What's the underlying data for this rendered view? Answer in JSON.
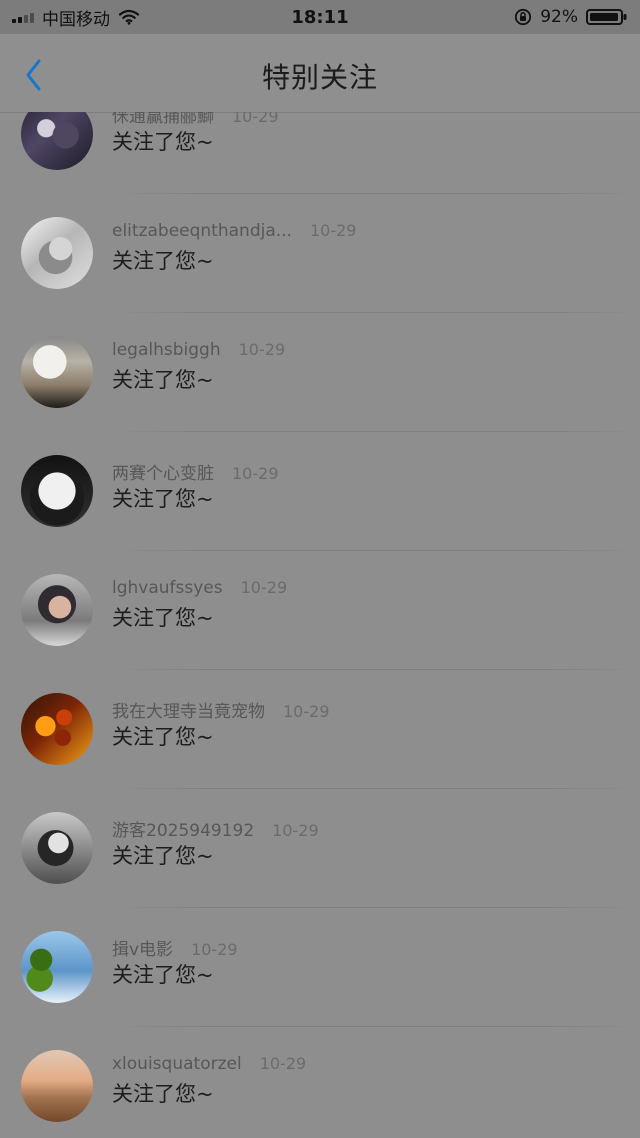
{
  "status_bar": {
    "carrier": "中国移动",
    "time": "18:11",
    "battery_percent": "92%",
    "icons": {
      "signal": "signal-icon",
      "wifi": "wifi-icon",
      "rotation_lock": "rotation-lock-icon",
      "battery": "battery-icon"
    }
  },
  "header": {
    "title": "特别关注",
    "back_icon": "back-icon",
    "accent_color": "#1677c9"
  },
  "feed": [
    {
      "username": "侎逋贏捅郦鰤",
      "time": "10-29",
      "message": "关注了您~",
      "avatar": "avatar-1"
    },
    {
      "username": "elitzabeeqnthandja...",
      "time": "10-29",
      "message": "关注了您~",
      "avatar": "avatar-2"
    },
    {
      "username": "legalhsbiggh",
      "time": "10-29",
      "message": "关注了您~",
      "avatar": "avatar-3"
    },
    {
      "username": "两賽个心变脏",
      "time": "10-29",
      "message": "关注了您~",
      "avatar": "avatar-4"
    },
    {
      "username": "lghvaufssyes",
      "time": "10-29",
      "message": "关注了您~",
      "avatar": "avatar-5"
    },
    {
      "username": "我在大理寺当竟宠物",
      "time": "10-29",
      "message": "关注了您~",
      "avatar": "avatar-6"
    },
    {
      "username": "游客2025949192",
      "time": "10-29",
      "message": "关注了您~",
      "avatar": "avatar-7"
    },
    {
      "username": "揖v电影",
      "time": "10-29",
      "message": "关注了您~",
      "avatar": "avatar-8"
    },
    {
      "username": "xlouisquatorzel",
      "time": "10-29",
      "message": "关注了您~",
      "avatar": "avatar-9"
    }
  ]
}
